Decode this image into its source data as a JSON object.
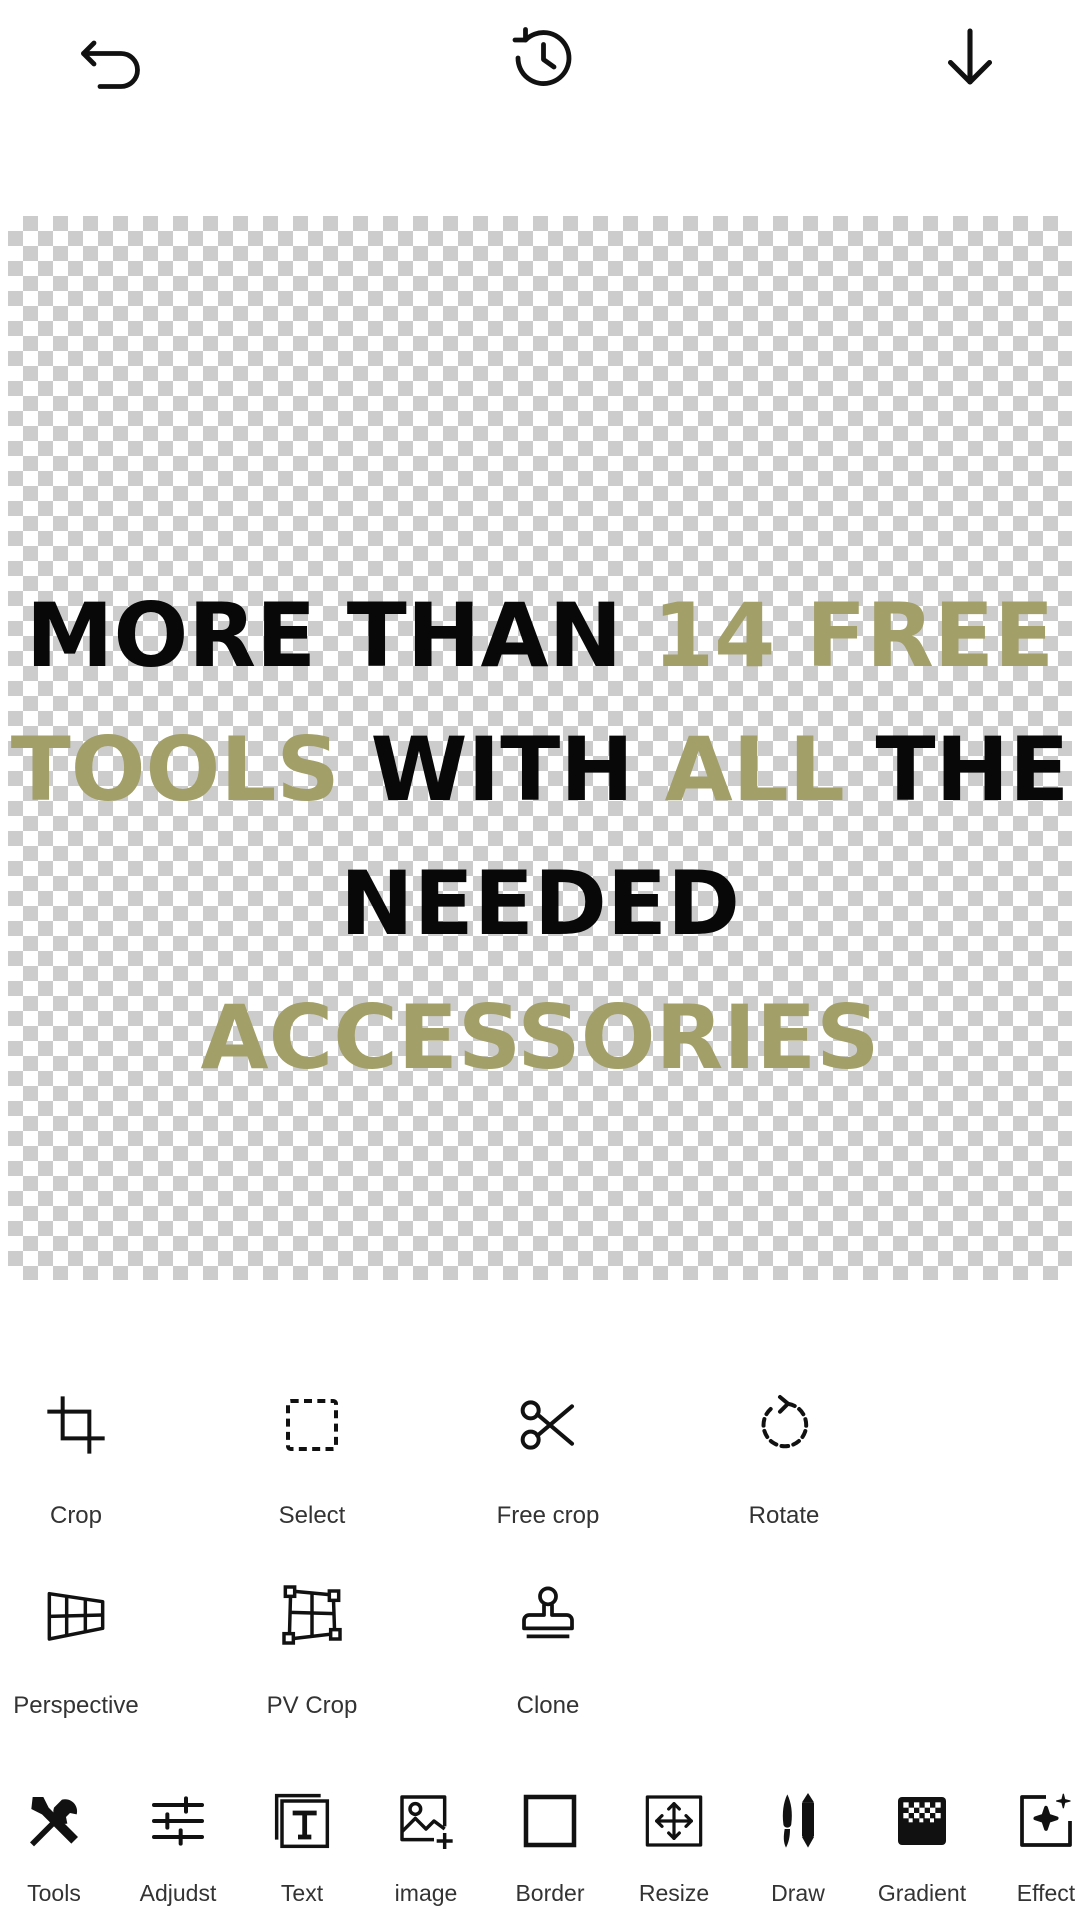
{
  "toolbar": {
    "undo_icon": "undo-icon",
    "history_icon": "history-icon",
    "download_icon": "download-icon"
  },
  "canvas": {
    "headline": [
      {
        "text": "MORE THAN ",
        "style": "dark"
      },
      {
        "text": "14 FREE",
        "style": "accent"
      },
      {
        "text": "TOOLS",
        "style": "accent"
      },
      {
        "text": " WITH ",
        "style": "dark"
      },
      {
        "text": "ALL",
        "style": "accent"
      },
      {
        "text": " THE",
        "style": "dark"
      },
      {
        "text": "NEEDED ",
        "style": "dark"
      },
      {
        "text": "ACCESSORIES",
        "style": "accent"
      }
    ],
    "colors": {
      "dark": "#080808",
      "accent": "#a29f68",
      "checker": "#cccccc"
    }
  },
  "tools": {
    "items": [
      {
        "label": "Crop",
        "icon": "crop-icon"
      },
      {
        "label": "Select",
        "icon": "select-icon"
      },
      {
        "label": "Free crop",
        "icon": "scissors-icon"
      },
      {
        "label": "Rotate",
        "icon": "rotate-icon"
      },
      {
        "label": "Perspective",
        "icon": "perspective-icon"
      },
      {
        "label": "PV Crop",
        "icon": "pv-crop-icon"
      },
      {
        "label": "Clone",
        "icon": "stamp-icon"
      }
    ]
  },
  "bottom_bar": {
    "items": [
      {
        "label": "Tools",
        "icon": "tools-icon"
      },
      {
        "label": "Adjudst",
        "icon": "sliders-icon"
      },
      {
        "label": "Text",
        "icon": "text-icon"
      },
      {
        "label": "image",
        "icon": "add-image-icon"
      },
      {
        "label": "Border",
        "icon": "border-icon"
      },
      {
        "label": "Resize",
        "icon": "resize-icon"
      },
      {
        "label": "Draw",
        "icon": "brush-icon"
      },
      {
        "label": "Gradient",
        "icon": "gradient-icon"
      },
      {
        "label": "Effect",
        "icon": "effect-icon"
      }
    ]
  }
}
